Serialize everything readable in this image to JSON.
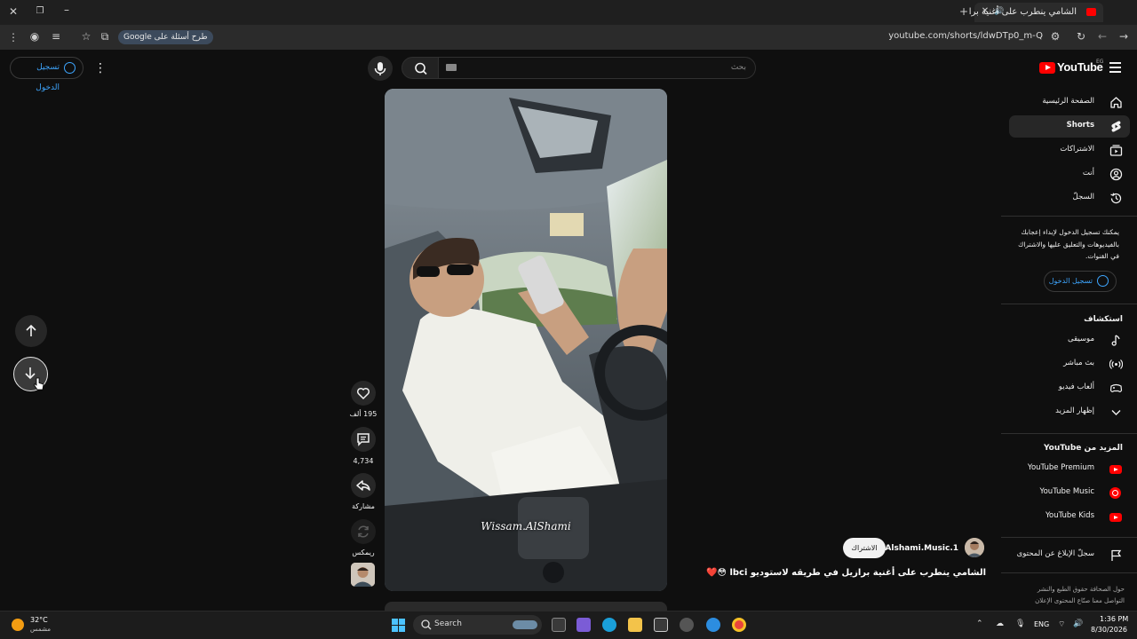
{
  "browser": {
    "tab_title": "الشامي ينطرب على أغنية برا",
    "url": "youtube.com/shorts/ldwDTp0_m-Q",
    "google_chip": "طرح أسئلة على Google",
    "icons": [
      "close-icon",
      "restore-icon",
      "minimize-icon",
      "new-tab-icon",
      "back-icon",
      "forward-icon",
      "reload-icon",
      "star-icon",
      "menu-icon"
    ]
  },
  "header": {
    "signin_label": "تسجيل الدخول",
    "search_placeholder": "بحث",
    "logo_text": "YouTube",
    "logo_country": "EG"
  },
  "sidebar": {
    "main_items": [
      {
        "label": "الصفحة الرئيسية",
        "icon": "home-icon"
      },
      {
        "label": "Shorts",
        "icon": "shorts-icon",
        "active": true
      },
      {
        "label": "الاشتراكات",
        "icon": "subscriptions-icon"
      },
      {
        "label": "أنت",
        "icon": "you-icon"
      },
      {
        "label": "السجلّ",
        "icon": "history-icon"
      }
    ],
    "signin_note": "يمكنك تسجيل الدخول لإبداء إعجابك بالفيديوهات والتعليق عليها والاشتراك في القنوات.",
    "signin_label": "تسجيل الدخول",
    "explore_heading": "استكشاف",
    "explore_items": [
      {
        "label": "موسيقى",
        "icon": "music-icon"
      },
      {
        "label": "بث مباشر",
        "icon": "live-icon"
      },
      {
        "label": "ألعاب فيديو",
        "icon": "gaming-icon"
      },
      {
        "label": "إظهار المزيد",
        "icon": "chevron-down-icon"
      }
    ],
    "more_heading": "المزيد من YouTube",
    "more_items": [
      {
        "label": "YouTube Premium"
      },
      {
        "label": "YouTube Music"
      },
      {
        "label": "YouTube Kids"
      }
    ],
    "report_label": "سجلّ الإبلاغ عن المحتوى",
    "footer_line1": "حول  الصحافة  حقوق الطبع والنشر",
    "footer_line2": "التواصل معنا  صنّاع المحتوى  الإعلان"
  },
  "short": {
    "watermark": "Wissam.AlShami",
    "likes": "195 ألف",
    "comments": "4,734",
    "share_label": "مشاركة",
    "remix_label": "ريمكس",
    "channel": "@Alshami.Music.1",
    "subscribe_label": "الاشتراك",
    "title": "الشامي ينطرب على أغنية برازيل في طريقه لاستوديو lbci 😳❤️"
  },
  "taskbar": {
    "weather_temp": "32°C",
    "weather_desc": "مشمس",
    "search_label": "Search",
    "language": "ENG",
    "time": "1:36 PM",
    "date": "8/30/2026"
  }
}
